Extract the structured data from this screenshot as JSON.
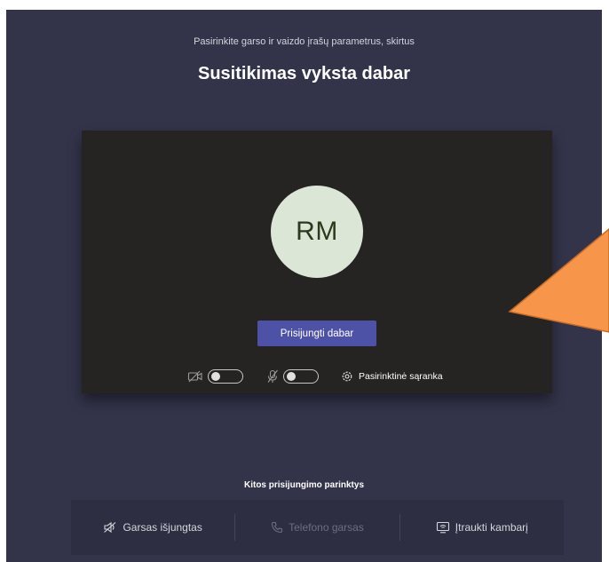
{
  "header": {
    "subtitle": "Pasirinkite garso ir vaizdo įrašų parametrus, skirtus",
    "title": "Susitikimas vyksta dabar"
  },
  "preview": {
    "avatar_initials": "RM",
    "join_button": "Prisijungti dabar",
    "video_toggle": "off",
    "mic_toggle": "off",
    "settings_label": "Pasirinktinė sąranka"
  },
  "options": {
    "title": "Kitos prisijungimo parinktys",
    "items": [
      {
        "label": "Garsas išjungtas",
        "icon": "speaker-off-icon",
        "enabled": true
      },
      {
        "label": "Telefono garsas",
        "icon": "phone-icon",
        "enabled": false
      },
      {
        "label": "Įtraukti kambarį",
        "icon": "room-icon",
        "enabled": true
      }
    ]
  },
  "colors": {
    "background": "#33344a",
    "preview_bg": "#252423",
    "accent": "#4e52a6",
    "avatar_bg": "#dce6d7",
    "annotation_arrow": "#f7964a"
  }
}
